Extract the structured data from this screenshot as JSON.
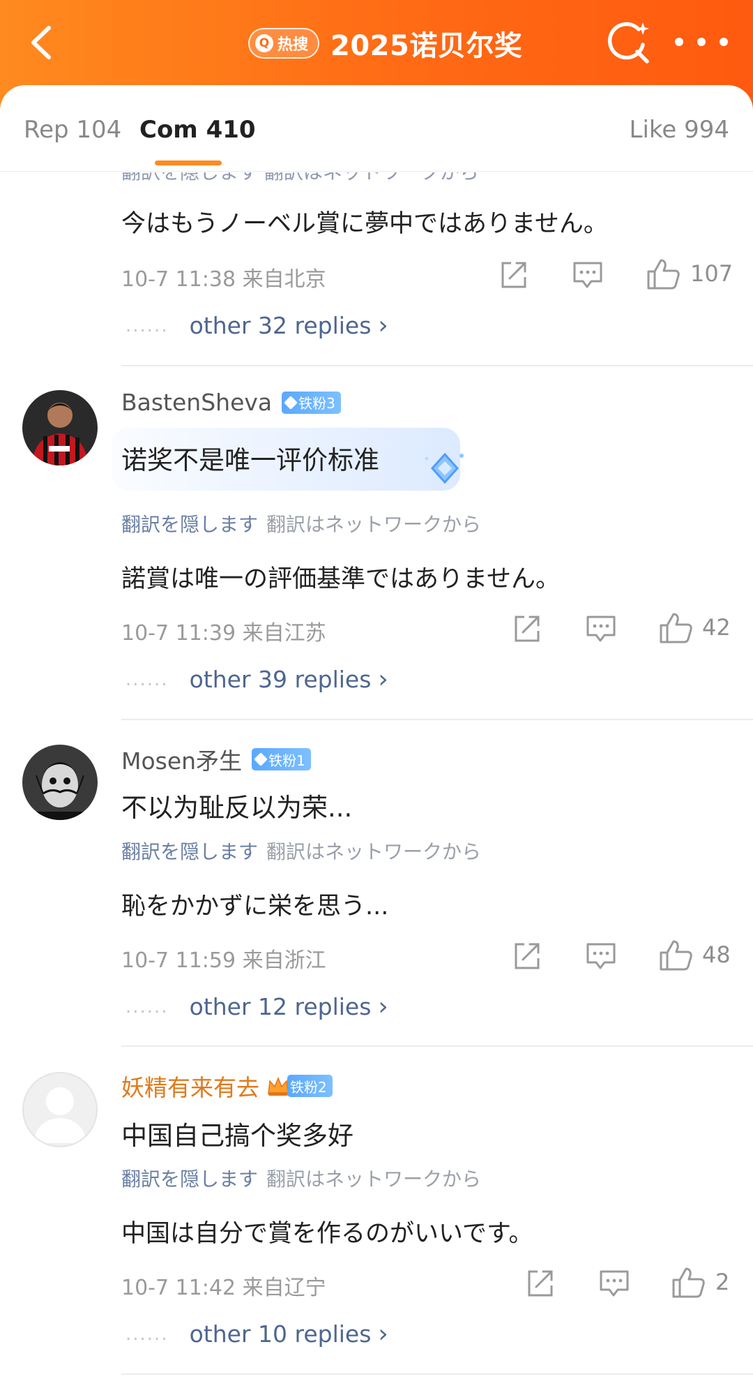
{
  "header": {
    "hot_label": "热搜",
    "title": "2025诺贝尔奖",
    "back_icon": "chevron-left-icon",
    "search_icon": "search-sparkle-icon",
    "more_icon": "more-dots-icon",
    "gradient_colors": [
      "#ff8a1f",
      "#ff5a10"
    ]
  },
  "tabs": {
    "rep": "Rep 104",
    "com": "Com 410",
    "like": "Like 994",
    "active": "com",
    "accent": "#ff8a1f"
  },
  "comments": [
    {
      "partial_translation_row": "翻訳を隠します 翻訳はネットワークから",
      "translation": "今はもうノーベル賞に夢中ではありません。",
      "time_location": "10-7 11:38  来自北京",
      "likes": "107",
      "replies": "other 32 replies"
    },
    {
      "username": "BastenSheva",
      "badge": "铁粉3",
      "text": "诺奖不是唯一评价标准",
      "hide_translation": "翻訳を隠します",
      "translation_source": "翻訳はネットワークから",
      "translation": "諾賞は唯一の評価基準ではありません。",
      "time_location": "10-7 11:39  来自江苏",
      "likes": "42",
      "replies": "other 39 replies"
    },
    {
      "username": "Mosen矛生",
      "badge": "铁粉1",
      "text": "不以为耻反以为荣...",
      "hide_translation": "翻訳を隠します",
      "translation_source": "翻訳はネットワークから",
      "translation": "恥をかかずに栄を思う...",
      "time_location": "10-7 11:59  来自浙江",
      "likes": "48",
      "replies": "other 12 replies"
    },
    {
      "username": "妖精有来有去",
      "badge": "铁粉2",
      "text": "中国自己搞个奖多好",
      "hide_translation": "翻訳を隠します",
      "translation_source": "翻訳はネットワークから",
      "translation": "中国は自分で賞を作るのがいいです。",
      "time_location": "10-7 11:42  来自辽宁",
      "likes": "2",
      "replies": "other 10 replies"
    }
  ],
  "dots_text": "......",
  "chevron": "›"
}
